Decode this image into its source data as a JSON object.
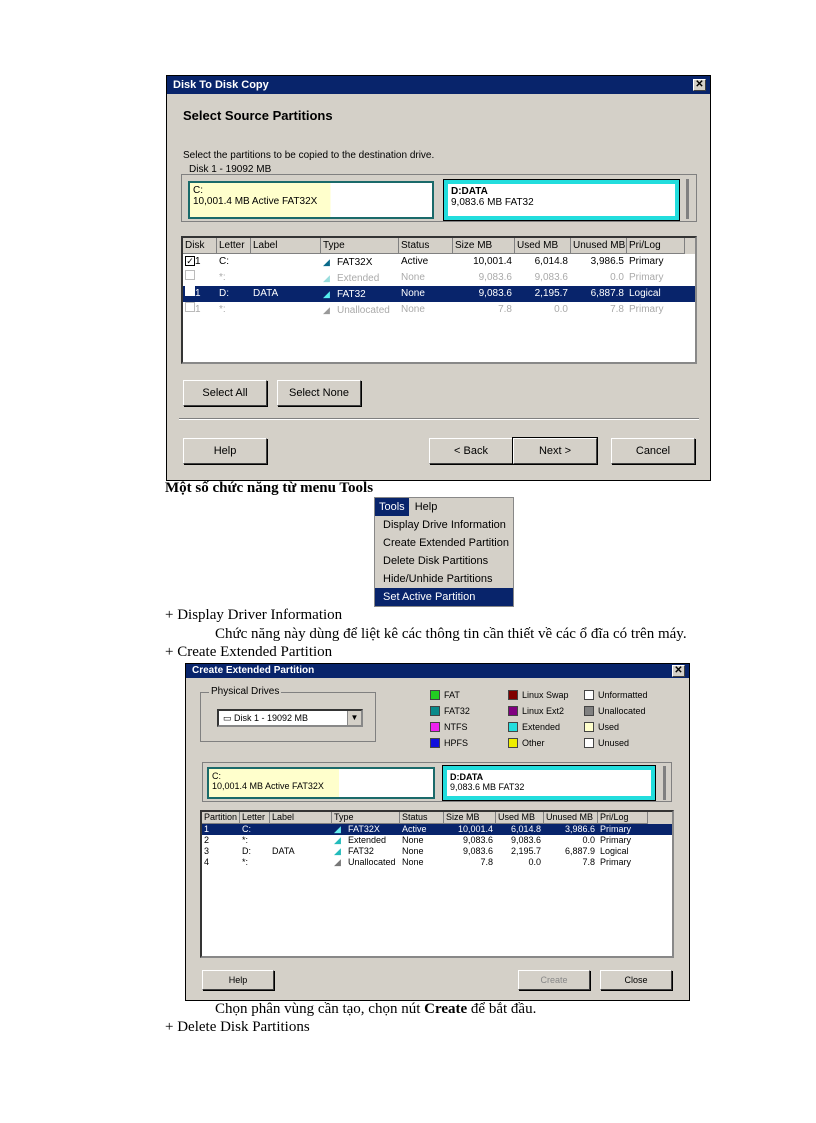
{
  "dialog1": {
    "title": "Disk To Disk Copy",
    "heading": "Select Source Partitions",
    "instruction": "Select the partitions to be copied to the destination drive.",
    "group_label": "Disk 1 - 19092 MB",
    "part_c": {
      "name": "C:",
      "desc": "10,001.4 MB Active FAT32X"
    },
    "part_d": {
      "name": "D:DATA",
      "desc": "9,083.6 MB FAT32"
    },
    "columns": [
      "Disk",
      "Letter",
      "Label",
      "Type",
      "Status",
      "Size MB",
      "Used MB",
      "Unused MB",
      "Pri/Log"
    ],
    "rows": [
      {
        "disk": "1",
        "letter": "C:",
        "label": "",
        "type": "FAT32X",
        "status": "Active",
        "size": "10,001.4",
        "used": "6,014.8",
        "unused": "3,986.5",
        "prilog": "Primary"
      },
      {
        "disk": "",
        "letter": "*:",
        "label": "",
        "type": "Extended",
        "status": "None",
        "size": "9,083.6",
        "used": "9,083.6",
        "unused": "0.0",
        "prilog": "Primary"
      },
      {
        "disk": "1",
        "letter": "D:",
        "label": "DATA",
        "type": "FAT32",
        "status": "None",
        "size": "9,083.6",
        "used": "2,195.7",
        "unused": "6,887.8",
        "prilog": "Logical"
      },
      {
        "disk": "1",
        "letter": "*:",
        "label": "",
        "type": "Unallocated",
        "status": "None",
        "size": "7.8",
        "used": "0.0",
        "unused": "7.8",
        "prilog": "Primary"
      }
    ],
    "select_all": "Select All",
    "select_none": "Select None",
    "help": "Help",
    "back": "< Back",
    "next": "Next >",
    "cancel": "Cancel"
  },
  "text": {
    "tools_heading": "Một số chức năng từ menu Tools",
    "item1": "+ Display Driver Information",
    "item1_desc": "Chức năng này dùng để liệt kê các thông tin cần thiết về các ổ đĩa có trên máy.",
    "item2": "+ Create Extended Partition",
    "create_desc_prefix": "Chọn phân vùng cần tạo, chọn nút ",
    "create_desc_bold": "Create",
    "create_desc_suffix": " để bắt đầu.",
    "item3": "+ Delete Disk Partitions"
  },
  "menu": {
    "bar": [
      "Tools",
      "Help"
    ],
    "items": [
      "Display Drive Information",
      "Create Extended Partition",
      "Delete Disk Partitions",
      "Hide/Unhide Partitions",
      "Set Active Partition"
    ]
  },
  "dialog2": {
    "title": "Create Extended Partition",
    "group_label": "Physical Drives",
    "drive_select": "Disk 1 - 19092 MB",
    "legend": [
      {
        "label": "FAT",
        "color": "#22cc22"
      },
      {
        "label": "Linux Swap",
        "color": "#800000"
      },
      {
        "label": "Unformatted",
        "color": "#ffffff"
      },
      {
        "label": "FAT32",
        "color": "#0a8a8a"
      },
      {
        "label": "Linux Ext2",
        "color": "#800080"
      },
      {
        "label": "Unallocated",
        "color": "#808080"
      },
      {
        "label": "NTFS",
        "color": "#ee22ee"
      },
      {
        "label": "Extended",
        "color": "#22dddd"
      },
      {
        "label": "Used",
        "color": "#ffffcc"
      },
      {
        "label": "HPFS",
        "color": "#1010dd"
      },
      {
        "label": "Other",
        "color": "#eeee00"
      },
      {
        "label": "Unused",
        "color": "#ffffff"
      }
    ],
    "part_c": {
      "name": "C:",
      "desc": "10,001.4 MB Active FAT32X"
    },
    "part_d": {
      "name": "D:DATA",
      "desc": "9,083.6 MB FAT32"
    },
    "columns": [
      "Partition",
      "Letter",
      "Label",
      "Type",
      "Status",
      "Size MB",
      "Used MB",
      "Unused MB",
      "Pri/Log"
    ],
    "rows": [
      {
        "partition": "1",
        "letter": "C:",
        "label": "",
        "type": "FAT32X",
        "status": "Active",
        "size": "10,001.4",
        "used": "6,014.8",
        "unused": "3,986.6",
        "prilog": "Primary"
      },
      {
        "partition": "2",
        "letter": "*:",
        "label": "",
        "type": "Extended",
        "status": "None",
        "size": "9,083.6",
        "used": "9,083.6",
        "unused": "0.0",
        "prilog": "Primary"
      },
      {
        "partition": "3",
        "letter": "D:",
        "label": "DATA",
        "type": "FAT32",
        "status": "None",
        "size": "9,083.6",
        "used": "2,195.7",
        "unused": "6,887.9",
        "prilog": "Logical"
      },
      {
        "partition": "4",
        "letter": "*:",
        "label": "",
        "type": "Unallocated",
        "status": "None",
        "size": "7.8",
        "used": "0.0",
        "unused": "7.8",
        "prilog": "Primary"
      }
    ],
    "help": "Help",
    "create": "Create",
    "close": "Close"
  }
}
